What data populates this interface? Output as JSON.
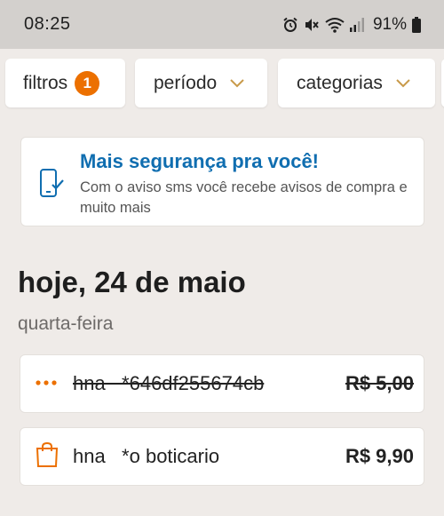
{
  "status_bar": {
    "time": "08:25",
    "battery": "91%",
    "icons": [
      "alarm-icon",
      "mute-icon",
      "wifi-icon",
      "signal-icon",
      "battery-icon"
    ]
  },
  "filters": {
    "filtros_label": "filtros",
    "filtros_count": "1",
    "periodo_label": "período",
    "categorias_label": "categorias"
  },
  "promo": {
    "title": "Mais segurança pra você!",
    "text": "Com o aviso sms você recebe avisos de compra e muito mais",
    "icon": "phone-check-icon"
  },
  "day": {
    "title": "hoje, 24 de maio",
    "weekday": "quarta-feira"
  },
  "transactions": [
    {
      "name": "hna   *646df255674cb",
      "amount": "R$ 5,00",
      "icon": "more-dots-icon",
      "cancelled": true
    },
    {
      "name": "hna   *o boticario",
      "amount": "R$ 9,90",
      "icon": "shopping-bag-icon",
      "cancelled": false
    }
  ],
  "colors": {
    "accent": "#ec7000",
    "promo_title": "#106eb0",
    "background": "#efebe8",
    "status_bar": "#d3d0cd"
  }
}
